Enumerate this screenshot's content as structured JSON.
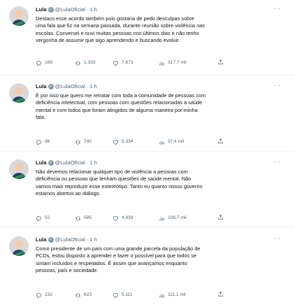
{
  "tweets": [
    {
      "name": "Lula",
      "handle": "@LulaOficial",
      "time": "1 h",
      "lines": [
        "Destaco esse acordo também pois gostaria de pedir desculpas sobre",
        "uma fala que fiz na semana passada, durante reunião sobre violência nas",
        "escolas. Conversei e ouvi muitas pessoas nos últimos dias e não tenho",
        "vergonha de assumir que sigo aprendendo e buscando evoluir."
      ],
      "replies": "189",
      "retweets": "1.333",
      "likes": "7.673",
      "views": "317,7 mil"
    },
    {
      "name": "Lula",
      "handle": "@LulaOficial",
      "time": "1 h",
      "lines": [
        "É por isso que quero me retratar com toda a comunidade de pessoas com",
        "deficiência intelectual, com pessoas com questões relacionadas à saúde",
        "mental e com todos que foram atingidos de alguma maneira por minha",
        "fala."
      ],
      "replies": "96",
      "retweets": "740",
      "likes": "5.334",
      "views": "97,4 mil"
    },
    {
      "name": "Lula",
      "handle": "@LulaOficial",
      "time": "1 h",
      "lines": [
        "Não devemos relacionar qualquer tipo de violência a pessoas com",
        "deficiência ou pessoas que tenham questões de saúde mental. Não",
        "vamos mais reproduzir esse estereótipo. Tanto eu quanto nosso governo",
        "estamos abertos ao diálogo."
      ],
      "replies": "52",
      "retweets": "585",
      "likes": "4.839",
      "views": "106,7 mil"
    },
    {
      "name": "Lula",
      "handle": "@LulaOficial",
      "time": "1 h",
      "lines": [
        "Como presidente de um país com uma grande parcela da população de",
        "PCDs, estou disposto a aprender e fazer o possível para que todos se",
        "sintam incluídos e respeitados. É assim que avançamos enquanto",
        "pessoas, país e sociedade."
      ],
      "replies": "132",
      "retweets": "623",
      "likes": "5.111",
      "views": "111,1 mil"
    }
  ],
  "icons": {
    "verified": "verified-badge-icon",
    "more": "more-options-icon",
    "reply": "reply-icon",
    "retweet": "retweet-icon",
    "like": "heart-icon",
    "views": "views-chart-icon",
    "share": "share-icon"
  },
  "colors": {
    "text": "#0f1419",
    "secondary": "#536471",
    "divider": "#eff3f4",
    "badge": "#829aab"
  }
}
